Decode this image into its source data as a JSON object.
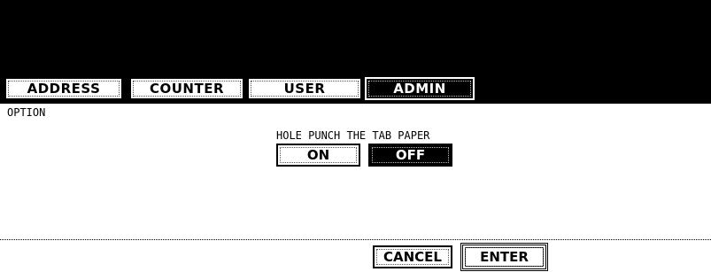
{
  "tabs": {
    "address": "ADDRESS",
    "counter": "COUNTER",
    "user": "USER",
    "admin": "ADMIN",
    "active": "admin"
  },
  "section": {
    "title": "OPTION"
  },
  "setting": {
    "label": "HOLE PUNCH THE TAB PAPER",
    "on_label": "ON",
    "off_label": "OFF",
    "selected": "OFF"
  },
  "footer": {
    "cancel_label": "CANCEL",
    "enter_label": "ENTER"
  },
  "colors": {
    "background": "#ffffff",
    "header": "#000000",
    "selected_fill": "#000000",
    "selected_text": "#ffffff",
    "text": "#000000"
  }
}
